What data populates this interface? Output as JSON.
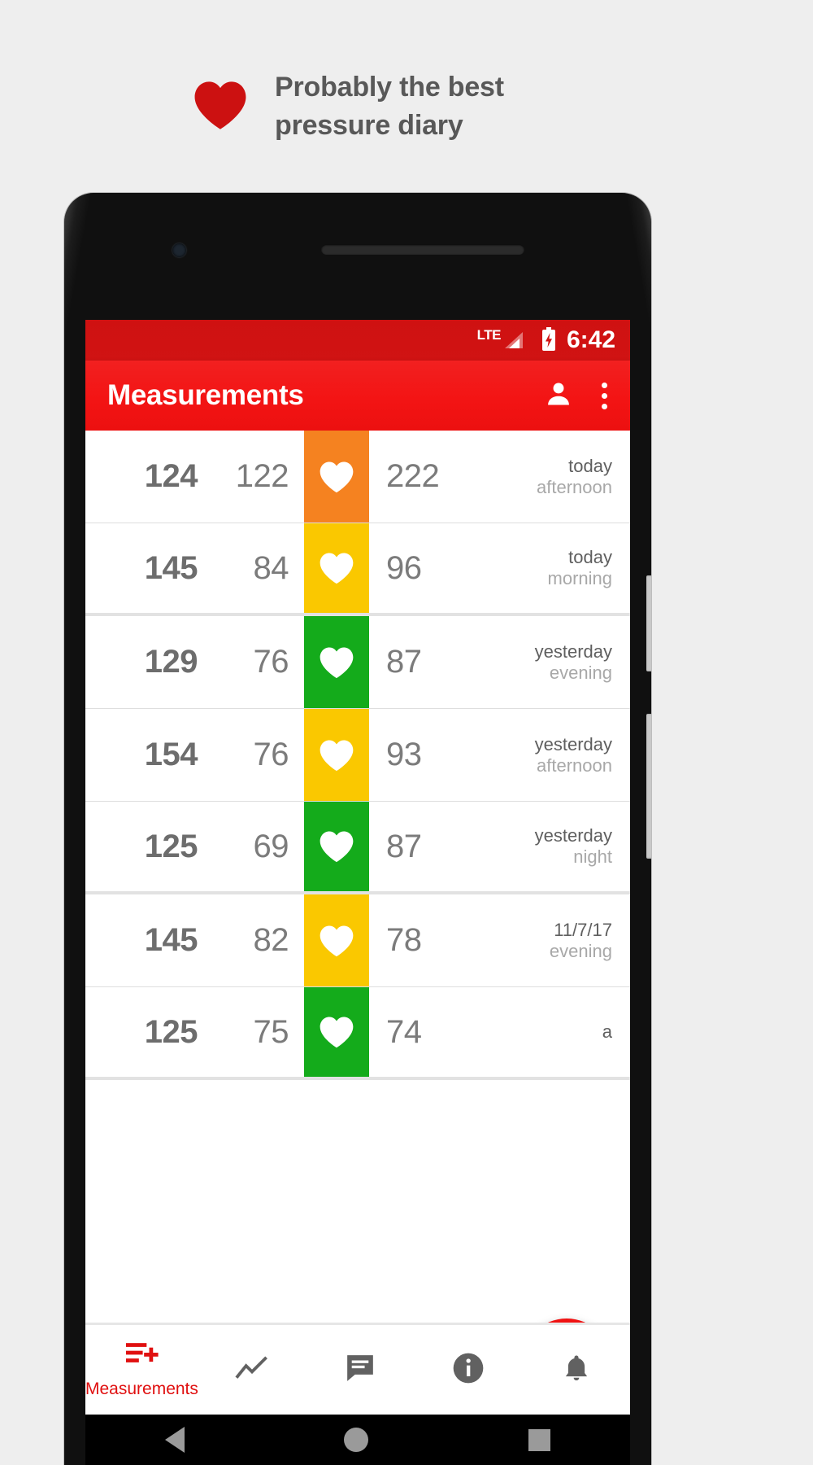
{
  "promo": {
    "icon": "heart-icon",
    "headline_line1": "Probably the best",
    "headline_line2": "pressure diary",
    "heart_color": "#cc1111",
    "text_color": "#585858"
  },
  "statusbar": {
    "network_label": "LTE",
    "signal_icon": "signal-bars-icon",
    "battery_icon": "battery-charging-icon",
    "time": "6:42",
    "background": "#d01313"
  },
  "appbar": {
    "title": "Measurements",
    "person_icon": "person-icon",
    "overflow_icon": "more-vertical-icon",
    "background": "#f31414"
  },
  "list": {
    "columns": [
      "systolic",
      "diastolic",
      "status",
      "pulse",
      "when"
    ],
    "rows": [
      {
        "systolic": "124",
        "diastolic": "122",
        "status_color": "#f58220",
        "status": "orange",
        "pulse": "222",
        "day": "today",
        "part": "afternoon",
        "group_end": false
      },
      {
        "systolic": "145",
        "diastolic": "84",
        "status_color": "#fac800",
        "status": "yellow",
        "pulse": "96",
        "day": "today",
        "part": "morning",
        "group_end": true
      },
      {
        "systolic": "129",
        "diastolic": "76",
        "status_color": "#14ab1b",
        "status": "green",
        "pulse": "87",
        "day": "yesterday",
        "part": "evening",
        "group_end": false
      },
      {
        "systolic": "154",
        "diastolic": "76",
        "status_color": "#fac800",
        "status": "yellow",
        "pulse": "93",
        "day": "yesterday",
        "part": "afternoon",
        "group_end": false
      },
      {
        "systolic": "125",
        "diastolic": "69",
        "status_color": "#14ab1b",
        "status": "green",
        "pulse": "87",
        "day": "yesterday",
        "part": "night",
        "group_end": true
      },
      {
        "systolic": "145",
        "diastolic": "82",
        "status_color": "#fac800",
        "status": "yellow",
        "pulse": "78",
        "day": "11/7/17",
        "part": "evening",
        "group_end": false
      },
      {
        "systolic": "125",
        "diastolic": "75",
        "status_color": "#14ab1b",
        "status": "green",
        "pulse": "74",
        "day": "a",
        "part": "",
        "group_end": true
      }
    ]
  },
  "fab": {
    "icon": "plus-icon",
    "color": "#f01212"
  },
  "bottomnav": {
    "items": [
      {
        "icon": "list-add-icon",
        "label": "Measurements",
        "active": true
      },
      {
        "icon": "line-chart-icon",
        "label": "",
        "active": false
      },
      {
        "icon": "comment-icon",
        "label": "",
        "active": false
      },
      {
        "icon": "info-circle-icon",
        "label": "",
        "active": false
      },
      {
        "icon": "bell-icon",
        "label": "",
        "active": false
      }
    ],
    "active_color": "#e01010",
    "inactive_color": "#616161"
  },
  "androidnav": {
    "back_icon": "triangle-back-icon",
    "home_icon": "circle-home-icon",
    "recents_icon": "square-recents-icon"
  }
}
